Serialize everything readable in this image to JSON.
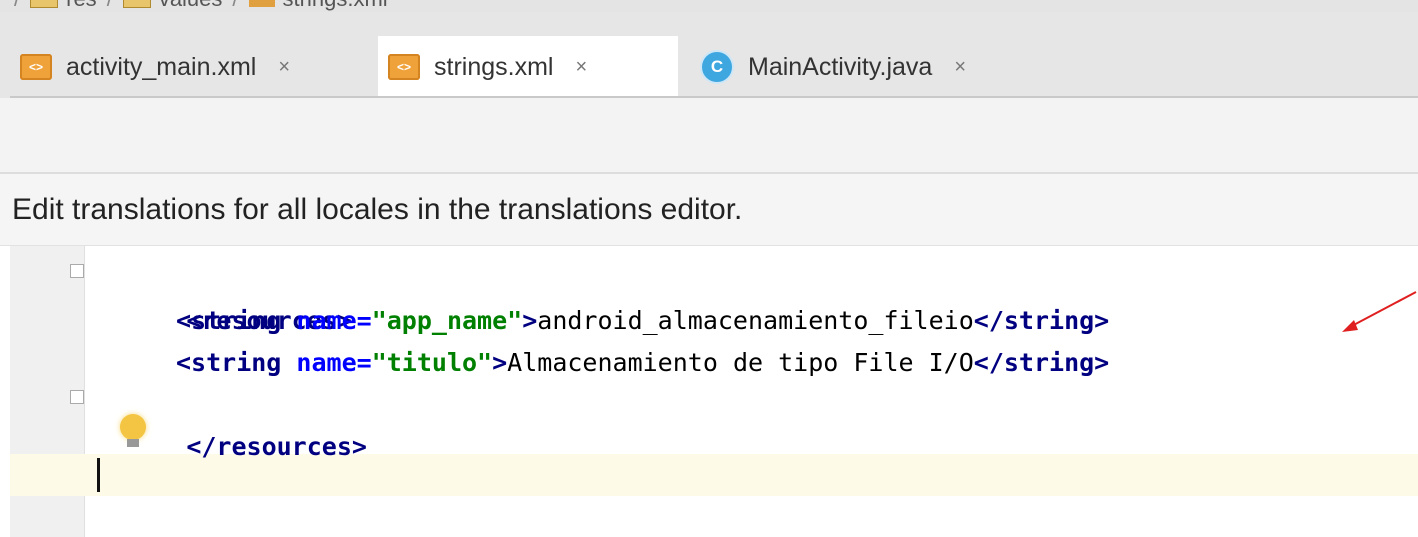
{
  "breadcrumb": {
    "items": [
      "res",
      "values",
      "strings.xml"
    ]
  },
  "tabs": [
    {
      "label": "activity_main.xml",
      "icon": "xml-file-icon",
      "close": "×",
      "active": false
    },
    {
      "label": "strings.xml",
      "icon": "xml-file-icon",
      "close": "×",
      "active": true
    },
    {
      "label": "MainActivity.java",
      "icon": "java-class-icon",
      "close": "×",
      "active": false
    }
  ],
  "icons": {
    "class_letter": "C",
    "xml_letter": "<>"
  },
  "banner": {
    "text": "Edit translations for all locales in the translations editor."
  },
  "code": {
    "line1_open": "<resources>",
    "line2": {
      "open": "<string ",
      "attr": "name=",
      "val": "\"app_name\"",
      "gt": ">",
      "text": "android_almacenamiento_fileio",
      "close": "</string>"
    },
    "line3": {
      "open": "<string ",
      "attr": "name=",
      "val": "\"titulo\"",
      "gt": ">",
      "text": "Almacenamiento de tipo File I/O",
      "close": "</string>"
    },
    "line4_close": "</resources>"
  },
  "colors": {
    "tag": "#000080",
    "attr": "#0000ff",
    "value": "#008000",
    "current_line": "#fdfbe8",
    "annotation_arrow": "#e02020"
  }
}
